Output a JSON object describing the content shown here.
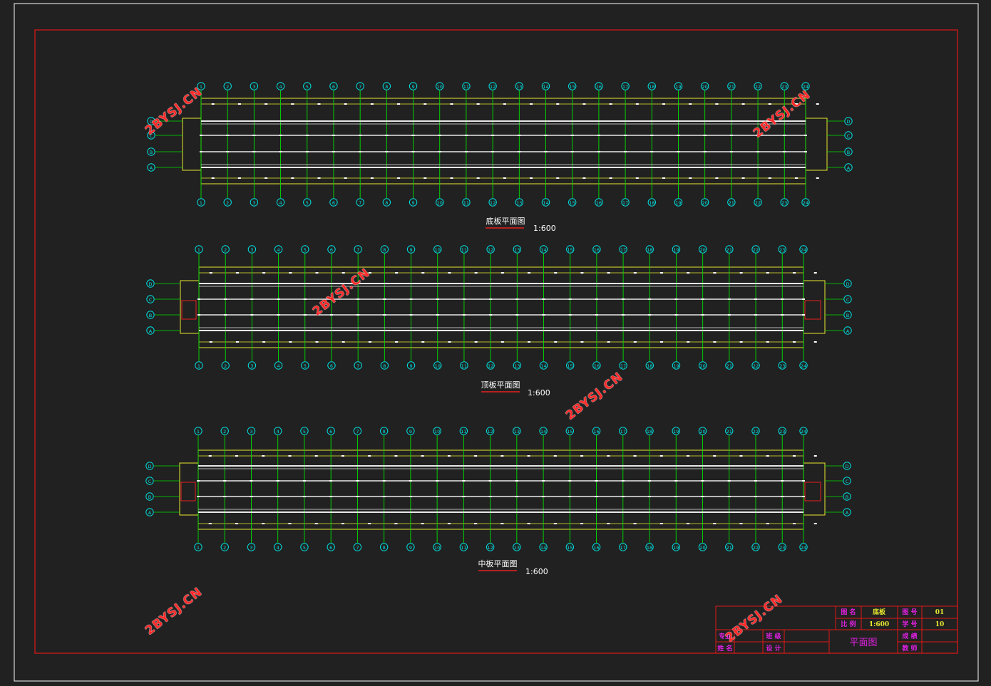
{
  "colors": {
    "background": "#212121",
    "frame": "#d8d8d8",
    "border": "#e01818",
    "axis": "#00e000",
    "bubble": "#00e0e0",
    "outline": "#e8e830",
    "slab": "#e8e8e8",
    "accent_red": "#e82020",
    "title_block_text": "#e020e0",
    "title_block_value": "#e8e830",
    "title_text": "#ffffff",
    "watermark": "#ff2a2a"
  },
  "watermark": "2BYSJ.CN",
  "axis_numbers": [
    "1",
    "2",
    "3",
    "4",
    "5",
    "6",
    "7",
    "8",
    "9",
    "10",
    "11",
    "12",
    "13",
    "14",
    "15",
    "16",
    "17",
    "18",
    "19",
    "20",
    "21",
    "22",
    "23",
    "24"
  ],
  "row_letters": [
    "D",
    "C",
    "B",
    "A"
  ],
  "plans": [
    {
      "name": "bottom-slab-plan",
      "title": "底板平面图",
      "scale": "1:600"
    },
    {
      "name": "top-slab-plan",
      "title": "顶板平面图",
      "scale": "1:600"
    },
    {
      "name": "middle-slab-plan",
      "title": "中板平面图",
      "scale": "1:600"
    }
  ],
  "title_block": {
    "drawing_name_label": "图 名",
    "drawing_name_value": "底板",
    "drawing_no_label": "图 号",
    "drawing_no_value": "01",
    "scale_label": "比 例",
    "scale_value": "1:600",
    "student_no_label": "学 号",
    "student_no_value": "10",
    "major_label": "专业",
    "class_label": "班 级",
    "name_label": "姓 名",
    "design_label": "设 计",
    "title": "平面图",
    "result_label": "成 绩",
    "teacher_label": "教 师"
  }
}
